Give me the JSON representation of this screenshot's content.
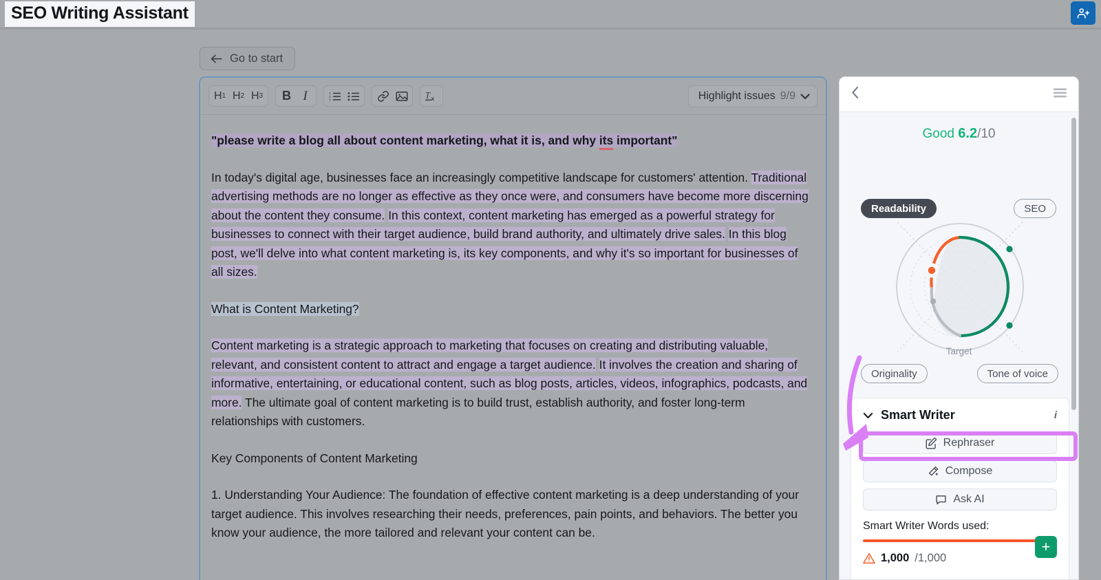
{
  "topbar": {
    "app_title": "SEO Writing Assistant",
    "invite_icon": "add-user-icon"
  },
  "toolbar_top": {
    "go_to_start": "Go to start",
    "back_arrow_icon": "arrow-left-icon"
  },
  "editor": {
    "toolbar": {
      "headings": [
        {
          "label": "H",
          "sub": "1",
          "name": "heading-1-button"
        },
        {
          "label": "H",
          "sub": "2",
          "name": "heading-2-button"
        },
        {
          "label": "H",
          "sub": "3",
          "name": "heading-3-button"
        }
      ],
      "bold_label": "B",
      "italic_label": "I",
      "ordered_list_icon": "ordered-list-icon",
      "bullet_list_icon": "bullet-list-icon",
      "link_icon": "link-icon",
      "image_icon": "image-icon",
      "clear_format_label": "Tx",
      "highlight_issues": {
        "label": "Highlight issues",
        "count": "9/9",
        "chevron_icon": "chevron-down-icon"
      }
    },
    "content": {
      "prompt_line": {
        "pre": "\"please write a blog all about content marketing, what it is, and why ",
        "misspelled": "its",
        "post": " important\""
      },
      "para1": {
        "seg1": "In today's digital age, businesses face an increasingly competitive landscape for customers' attention.",
        "seg2": "Traditional advertising methods are no longer as effective as they once were, and consumers have become more discerning about the content they consume.",
        "seg3": "In this context, content marketing has emerged as a powerful strategy for businesses to connect with their target audience, build brand authority, and ultimately drive sales.",
        "seg4": "In this blog post, we'll delve into what content marketing is, its key components, and why it's so important for businesses of all sizes."
      },
      "heading1": "What is Content Marketing?",
      "para2": {
        "seg1": "Content marketing is a strategic approach to marketing that focuses on creating and distributing valuable, relevant, and consistent content to attract and engage a target audience.",
        "seg2": "It involves the creation and sharing of informative, entertaining, or educational content, such as blog posts, articles, videos, infographics, podcasts, and more.",
        "seg3": "The ultimate goal of content marketing is to build trust, establish authority, and foster long-term relationships with customers."
      },
      "heading2": "Key Components of Content Marketing",
      "para3": "1. Understanding Your Audience: The foundation of effective content marketing is a deep understanding of your target audience. This involves researching their needs, preferences, pain points, and behaviors. The better you know your audience, the more tailored and relevant your content can be."
    }
  },
  "panel": {
    "header": {
      "back_icon": "chevron-left-icon",
      "menu_icon": "hamburger-menu-icon"
    },
    "score": {
      "rating": "Good",
      "value": "6.2",
      "max": "/10"
    },
    "pills": {
      "readability": "Readability",
      "seo": "SEO",
      "originality": "Originality",
      "tone_of_voice": "Tone of voice"
    },
    "radar": {
      "target_label": "Target"
    },
    "smart_writer": {
      "title": "Smart Writer",
      "collapse_icon": "chevron-down-icon",
      "info_icon": "info-icon",
      "buttons": [
        {
          "label": "Rephraser",
          "icon": "edit-square-icon",
          "name": "rephraser-button"
        },
        {
          "label": "Compose",
          "icon": "magic-wand-icon",
          "name": "compose-button"
        },
        {
          "label": "Ask AI",
          "icon": "chat-bubble-icon",
          "name": "ask-ai-button"
        }
      ],
      "words_label": "Smart Writer Words used:",
      "warning_icon": "warning-triangle-icon",
      "words_used": "1,000",
      "words_total": "/1,000",
      "add_label": "+"
    }
  },
  "chart_data": {
    "type": "radar",
    "title": "Content score radar",
    "axes": [
      "Readability",
      "SEO",
      "Tone of voice",
      "Originality"
    ],
    "target_ring_label": "Target",
    "series": [
      {
        "name": "Readability",
        "color": "#f4622a",
        "value": 4.2
      },
      {
        "name": "SEO",
        "color": "#0d8a62",
        "value": 9.0
      },
      {
        "name": "Tone of voice",
        "color": "#0d8a62",
        "value": 9.0
      },
      {
        "name": "Originality",
        "color": "#a9aeb4",
        "value": 2.5
      }
    ],
    "scale": [
      0,
      10
    ],
    "grid": true,
    "legend": false
  },
  "annotation": {
    "arrow_color": "#d980f5",
    "highlight_target": "compose-button"
  }
}
